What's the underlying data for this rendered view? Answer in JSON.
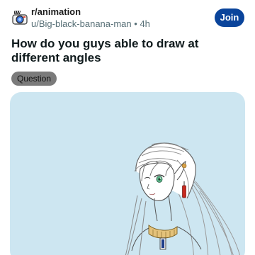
{
  "post": {
    "subreddit": "r/animation",
    "author": "u/Big-black-banana-man",
    "separator": "•",
    "age": "4h",
    "join_label": "Join",
    "title": "How do you guys able to draw at different angles",
    "flair": "Question"
  },
  "colors": {
    "join_button": "#0a449b",
    "flair_bg": "#7b7b7b",
    "media_bg": "#cde6f1",
    "title_text": "#0f1a1c",
    "meta_text": "#576f76"
  },
  "icons": {
    "subreddit_avatar": "camera-icon"
  }
}
